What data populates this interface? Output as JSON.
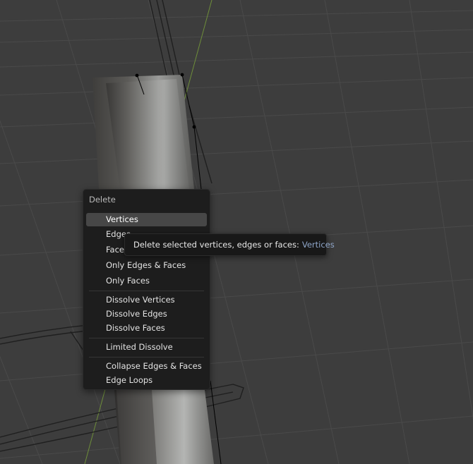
{
  "delete_menu": {
    "title": "Delete",
    "items": [
      {
        "label": "Vertices",
        "active": true
      },
      {
        "label": "Edges"
      },
      {
        "label": "Faces"
      },
      {
        "label": "Only Edges & Faces"
      },
      {
        "label": "Only Faces"
      },
      {
        "label": "Dissolve Vertices"
      },
      {
        "label": "Dissolve Edges"
      },
      {
        "label": "Dissolve Faces"
      },
      {
        "label": "Limited Dissolve"
      },
      {
        "label": "Collapse Edges & Faces"
      },
      {
        "label": "Edge Loops"
      }
    ]
  },
  "tooltip": {
    "text": "Delete selected vertices, edges or faces:",
    "value": "Vertices"
  },
  "colors": {
    "viewport_background": "#3d3d3d",
    "grid_line": "#4a4a4a",
    "y_axis": "#6e8e3a",
    "menu_background": "#1d1d1d",
    "highlight": "#474747",
    "tooltip_value": "#8fa6c9"
  }
}
